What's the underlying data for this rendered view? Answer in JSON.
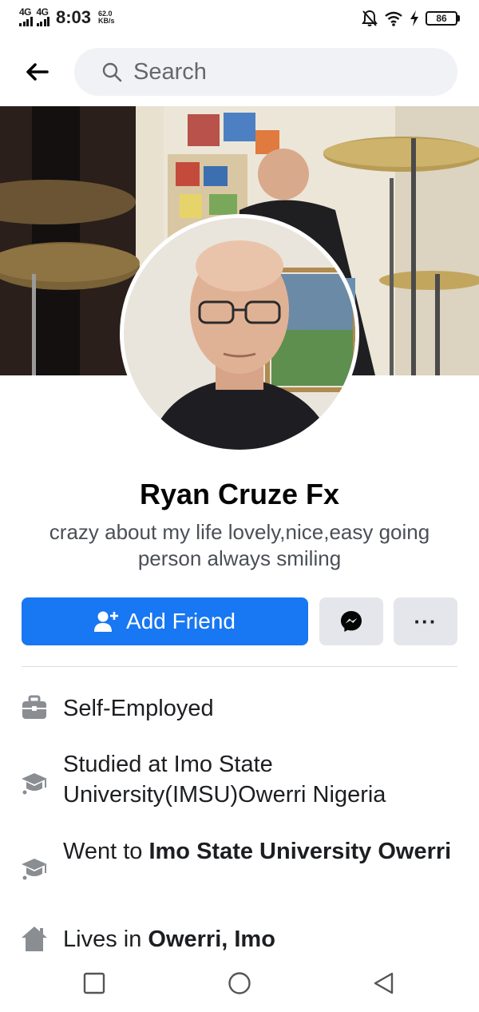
{
  "status_bar": {
    "network_1": "4G",
    "network_2": "4G",
    "time": "8:03",
    "speed_value": "62.0",
    "speed_unit": "KB/s",
    "battery": "86",
    "icons": [
      "mute-icon",
      "wifi-icon",
      "charging-icon",
      "battery-icon"
    ]
  },
  "top_nav": {
    "back_icon": "arrow-left-icon",
    "search_placeholder": "Search"
  },
  "profile": {
    "name": "Ryan Cruze Fx",
    "bio": "crazy about my life lovely,nice,easy going person always smiling"
  },
  "actions": {
    "add_friend_label": "Add Friend",
    "add_friend_icon": "add-friend-icon",
    "messenger_icon": "messenger-icon",
    "more_label": "···"
  },
  "colors": {
    "primary": "#1877f2",
    "secondary_button": "#e4e6eb",
    "search_bg": "#f0f2f5",
    "icon_gray": "#8a8d91"
  },
  "intro": {
    "work": "Self-Employed",
    "studied": "Studied at Imo State University(IMSU)Owerri Nigeria",
    "went_prefix": "Went to ",
    "went_school": "Imo State University Owerri",
    "lives_prefix": "Lives in ",
    "lives_place": "Owerri, Imo"
  },
  "system_nav": [
    "recents-square-icon",
    "home-circle-icon",
    "back-triangle-icon"
  ]
}
